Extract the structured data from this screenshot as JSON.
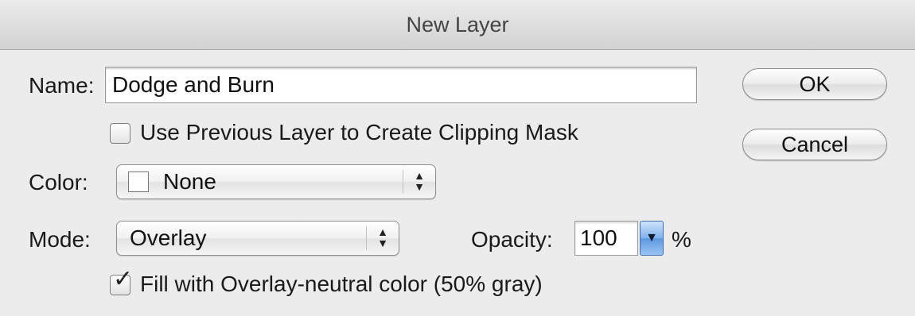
{
  "window": {
    "title": "New Layer"
  },
  "form": {
    "name_label": "Name:",
    "name_value": "Dodge and Burn",
    "clipping_label": "Use Previous Layer to Create Clipping Mask",
    "clipping_checked": false,
    "color_label": "Color:",
    "color_value": "None",
    "mode_label": "Mode:",
    "mode_value": "Overlay",
    "opacity_label": "Opacity:",
    "opacity_value": "100",
    "opacity_unit": "%",
    "fill_label": "Fill with Overlay-neutral color (50% gray)",
    "fill_checked": true
  },
  "buttons": {
    "ok_label": "OK",
    "cancel_label": "Cancel"
  },
  "glyphs": {
    "checkmark": "✓",
    "updown": "▲▼",
    "dropdown": "▼"
  },
  "colors": {
    "accent": "#5d98e0",
    "background": "#ececec"
  },
  "icons": {
    "color_swatch": "color-swatch-icon",
    "popup_arrows": "updown-arrows-icon",
    "opacity_dropdown": "dropdown-arrow-icon"
  }
}
